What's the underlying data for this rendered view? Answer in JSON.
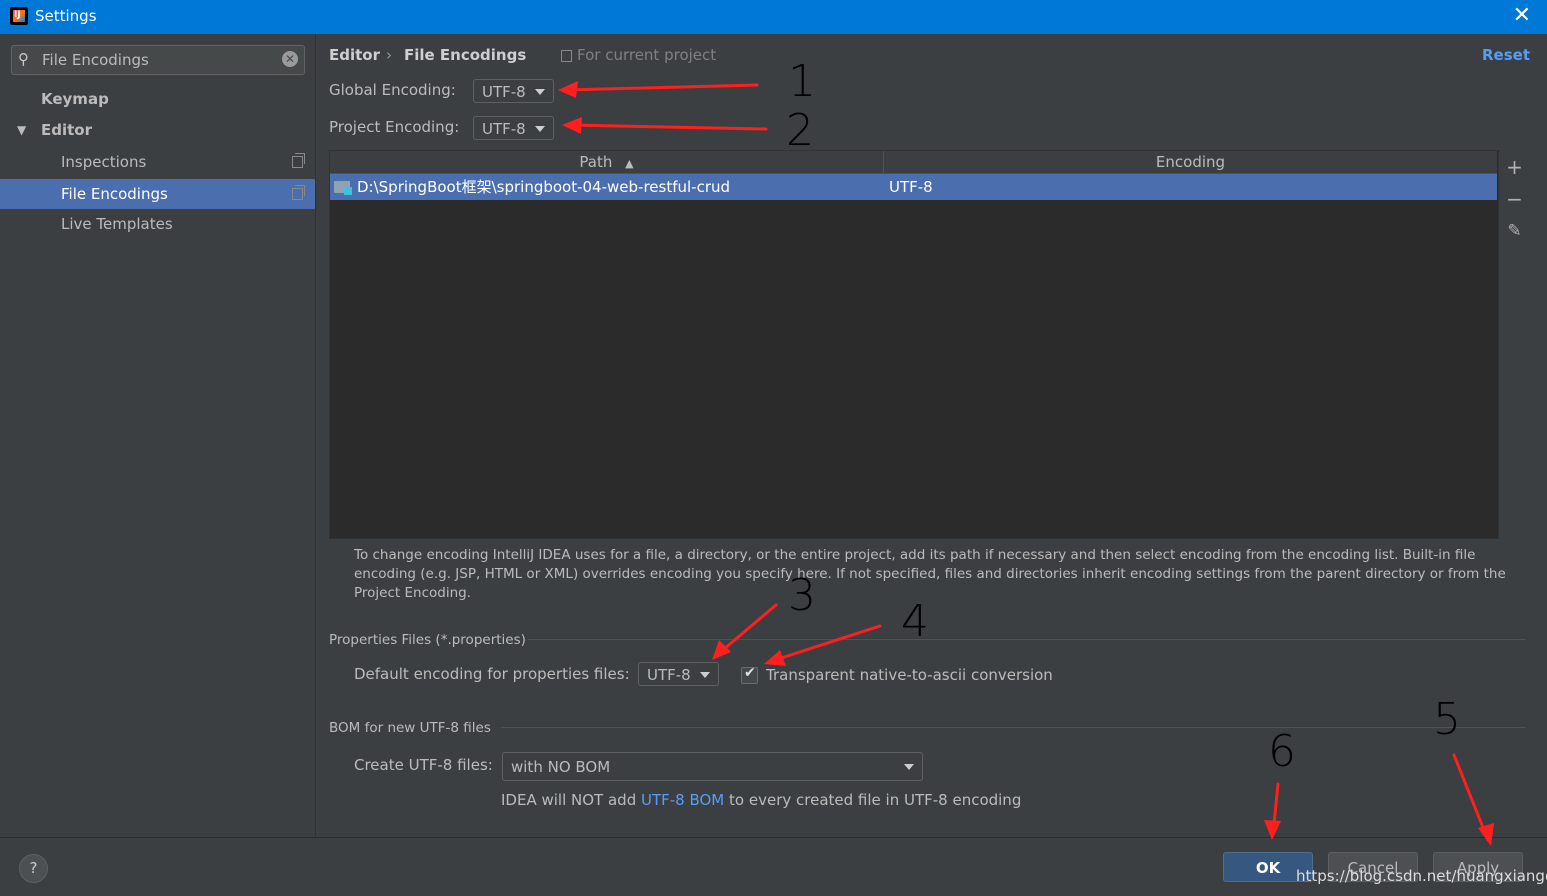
{
  "window": {
    "title": "Settings",
    "close_glyph": "✕"
  },
  "search": {
    "value": "File Encodings",
    "icon": "search-icon",
    "clear_glyph": "✕"
  },
  "sidebar": {
    "items": [
      {
        "label": "Keymap"
      },
      {
        "label": "Editor",
        "expander": "▼"
      },
      {
        "label": "Inspections"
      },
      {
        "label": "File Encodings",
        "selected": true
      },
      {
        "label": "Live Templates"
      }
    ]
  },
  "breadcrumb": {
    "parent": "Editor",
    "separator": "›",
    "current": "File Encodings",
    "scope": "For current project"
  },
  "reset_label": "Reset",
  "global_encoding": {
    "label": "Global Encoding:",
    "value": "UTF-8"
  },
  "project_encoding": {
    "label": "Project Encoding:",
    "value": "UTF-8"
  },
  "table": {
    "columns": [
      "Path",
      "Encoding"
    ],
    "sort_indicator": "▲",
    "rows": [
      {
        "path": "D:\\SpringBoot框架\\springboot-04-web-restful-crud",
        "encoding": "UTF-8"
      }
    ],
    "tools": {
      "add": "+",
      "remove": "−",
      "edit": "✎"
    }
  },
  "help_text": "To change encoding IntelliJ IDEA uses for a file, a directory, or the entire project, add its path if necessary and then select encoding from the encoding list. Built-in file encoding (e.g. JSP, HTML or XML) overrides encoding you specify here. If not specified, files and directories inherit encoding settings from the parent directory or from the Project Encoding.",
  "properties": {
    "section_title": "Properties Files (*.properties)",
    "default_label": "Default encoding for properties files:",
    "default_value": "UTF-8",
    "transparent_label": "Transparent native-to-ascii conversion",
    "transparent_checked": true,
    "check_glyph": "✔"
  },
  "bom": {
    "section_title": "BOM for new UTF-8 files",
    "create_label": "Create UTF-8 files:",
    "create_value": "with NO BOM",
    "note_prefix": "IDEA will NOT add ",
    "note_link": "UTF-8 BOM",
    "note_suffix": " to every created file in UTF-8 encoding"
  },
  "footer": {
    "help_glyph": "?",
    "ok": "OK",
    "cancel": "Cancel",
    "apply": "Apply"
  },
  "watermark": "https://blog.csdn.net/huangxiangdi",
  "annotations": [
    "1",
    "2",
    "3",
    "4",
    "5",
    "6"
  ],
  "colors": {
    "accent": "#0078d7",
    "selection": "#4b6eaf",
    "annotation": "#ff1f1f",
    "link": "#589df6"
  }
}
